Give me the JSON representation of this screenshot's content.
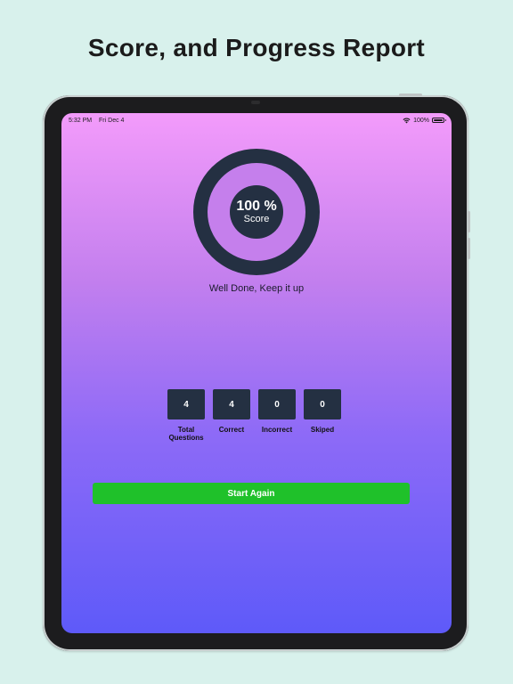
{
  "promo": {
    "title": "Score, and Progress Report"
  },
  "status_bar": {
    "time": "5:32 PM",
    "date": "Fri Dec 4",
    "battery": "100%"
  },
  "score": {
    "value": "100 %",
    "label": "Score",
    "progress_fraction": 1.0
  },
  "message": "Well Done, Keep it up",
  "stats": [
    {
      "value": "4",
      "label": "Total\nQuestions"
    },
    {
      "value": "4",
      "label": "Correct"
    },
    {
      "value": "0",
      "label": "Incorrect"
    },
    {
      "value": "0",
      "label": "Skiped"
    }
  ],
  "actions": {
    "start_again_label": "Start Again"
  },
  "colors": {
    "background": "#d8f1ec",
    "ring": "#243042",
    "button": "#1fc12a",
    "gradient_top": "#f39bfb",
    "gradient_bottom": "#5e5af9"
  }
}
